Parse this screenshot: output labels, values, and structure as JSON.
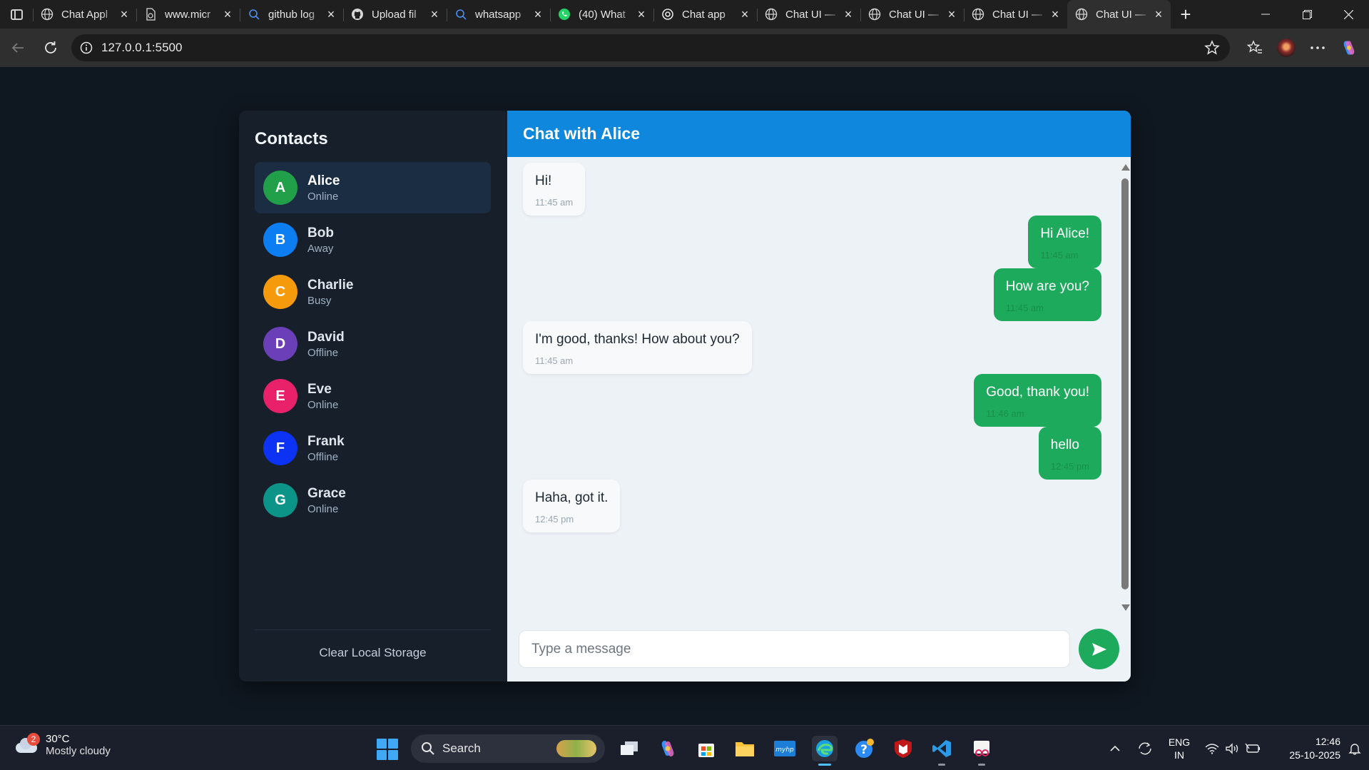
{
  "browser": {
    "tabs": [
      {
        "title": "Chat Appl",
        "icon": "globe-icon"
      },
      {
        "title": "www.micr",
        "icon": "document-icon"
      },
      {
        "title": "github log",
        "icon": "search-icon"
      },
      {
        "title": "Upload fil",
        "icon": "github-icon"
      },
      {
        "title": "whatsapp",
        "icon": "search-icon"
      },
      {
        "title": "(40) What",
        "icon": "whatsapp-icon"
      },
      {
        "title": "Chat app",
        "icon": "chatgpt-icon"
      },
      {
        "title": "Chat UI —",
        "icon": "globe-icon"
      },
      {
        "title": "Chat UI —",
        "icon": "globe-icon"
      },
      {
        "title": "Chat UI —",
        "icon": "globe-icon"
      },
      {
        "title": "Chat UI —",
        "icon": "globe-icon"
      }
    ],
    "active_tab_index": 10,
    "url": "127.0.0.1:5500"
  },
  "sidebar": {
    "title": "Contacts",
    "contacts": [
      {
        "initial": "A",
        "name": "Alice",
        "status": "Online",
        "color": "#21a049"
      },
      {
        "initial": "B",
        "name": "Bob",
        "status": "Away",
        "color": "#0d7ef2"
      },
      {
        "initial": "C",
        "name": "Charlie",
        "status": "Busy",
        "color": "#f59a0b"
      },
      {
        "initial": "D",
        "name": "David",
        "status": "Offline",
        "color": "#6a3fb7"
      },
      {
        "initial": "E",
        "name": "Eve",
        "status": "Online",
        "color": "#e9216a"
      },
      {
        "initial": "F",
        "name": "Frank",
        "status": "Offline",
        "color": "#0c33f4"
      },
      {
        "initial": "G",
        "name": "Grace",
        "status": "Online",
        "color": "#0c9488"
      }
    ],
    "active_contact_index": 0,
    "clear_label": "Clear Local Storage"
  },
  "chat": {
    "title": "Chat with Alice",
    "messages": [
      {
        "text": "Hi!",
        "time": "11:45 am",
        "direction": "in"
      },
      {
        "text": "Hi Alice!",
        "time": "11:45 am",
        "direction": "out"
      },
      {
        "text": "How are you?",
        "time": "11:45 am",
        "direction": "out"
      },
      {
        "text": "I'm good, thanks! How about you?",
        "time": "11:45 am",
        "direction": "in"
      },
      {
        "text": "Good, thank you!",
        "time": "11:46 am",
        "direction": "out"
      },
      {
        "text": "hello",
        "time": "12:45 pm",
        "direction": "out"
      },
      {
        "text": "Haha, got it.",
        "time": "12:45 pm",
        "direction": "in"
      }
    ],
    "input_placeholder": "Type a message",
    "input_value": "",
    "accent_color": "#0f87dc",
    "outgoing_color": "#1eaa5d"
  },
  "taskbar": {
    "weather_temp": "30°C",
    "weather_condition": "Mostly cloudy",
    "weather_badge": "2",
    "search_label": "Search",
    "language_line1": "ENG",
    "language_line2": "IN",
    "time": "12:46",
    "date": "25-10-2025"
  }
}
